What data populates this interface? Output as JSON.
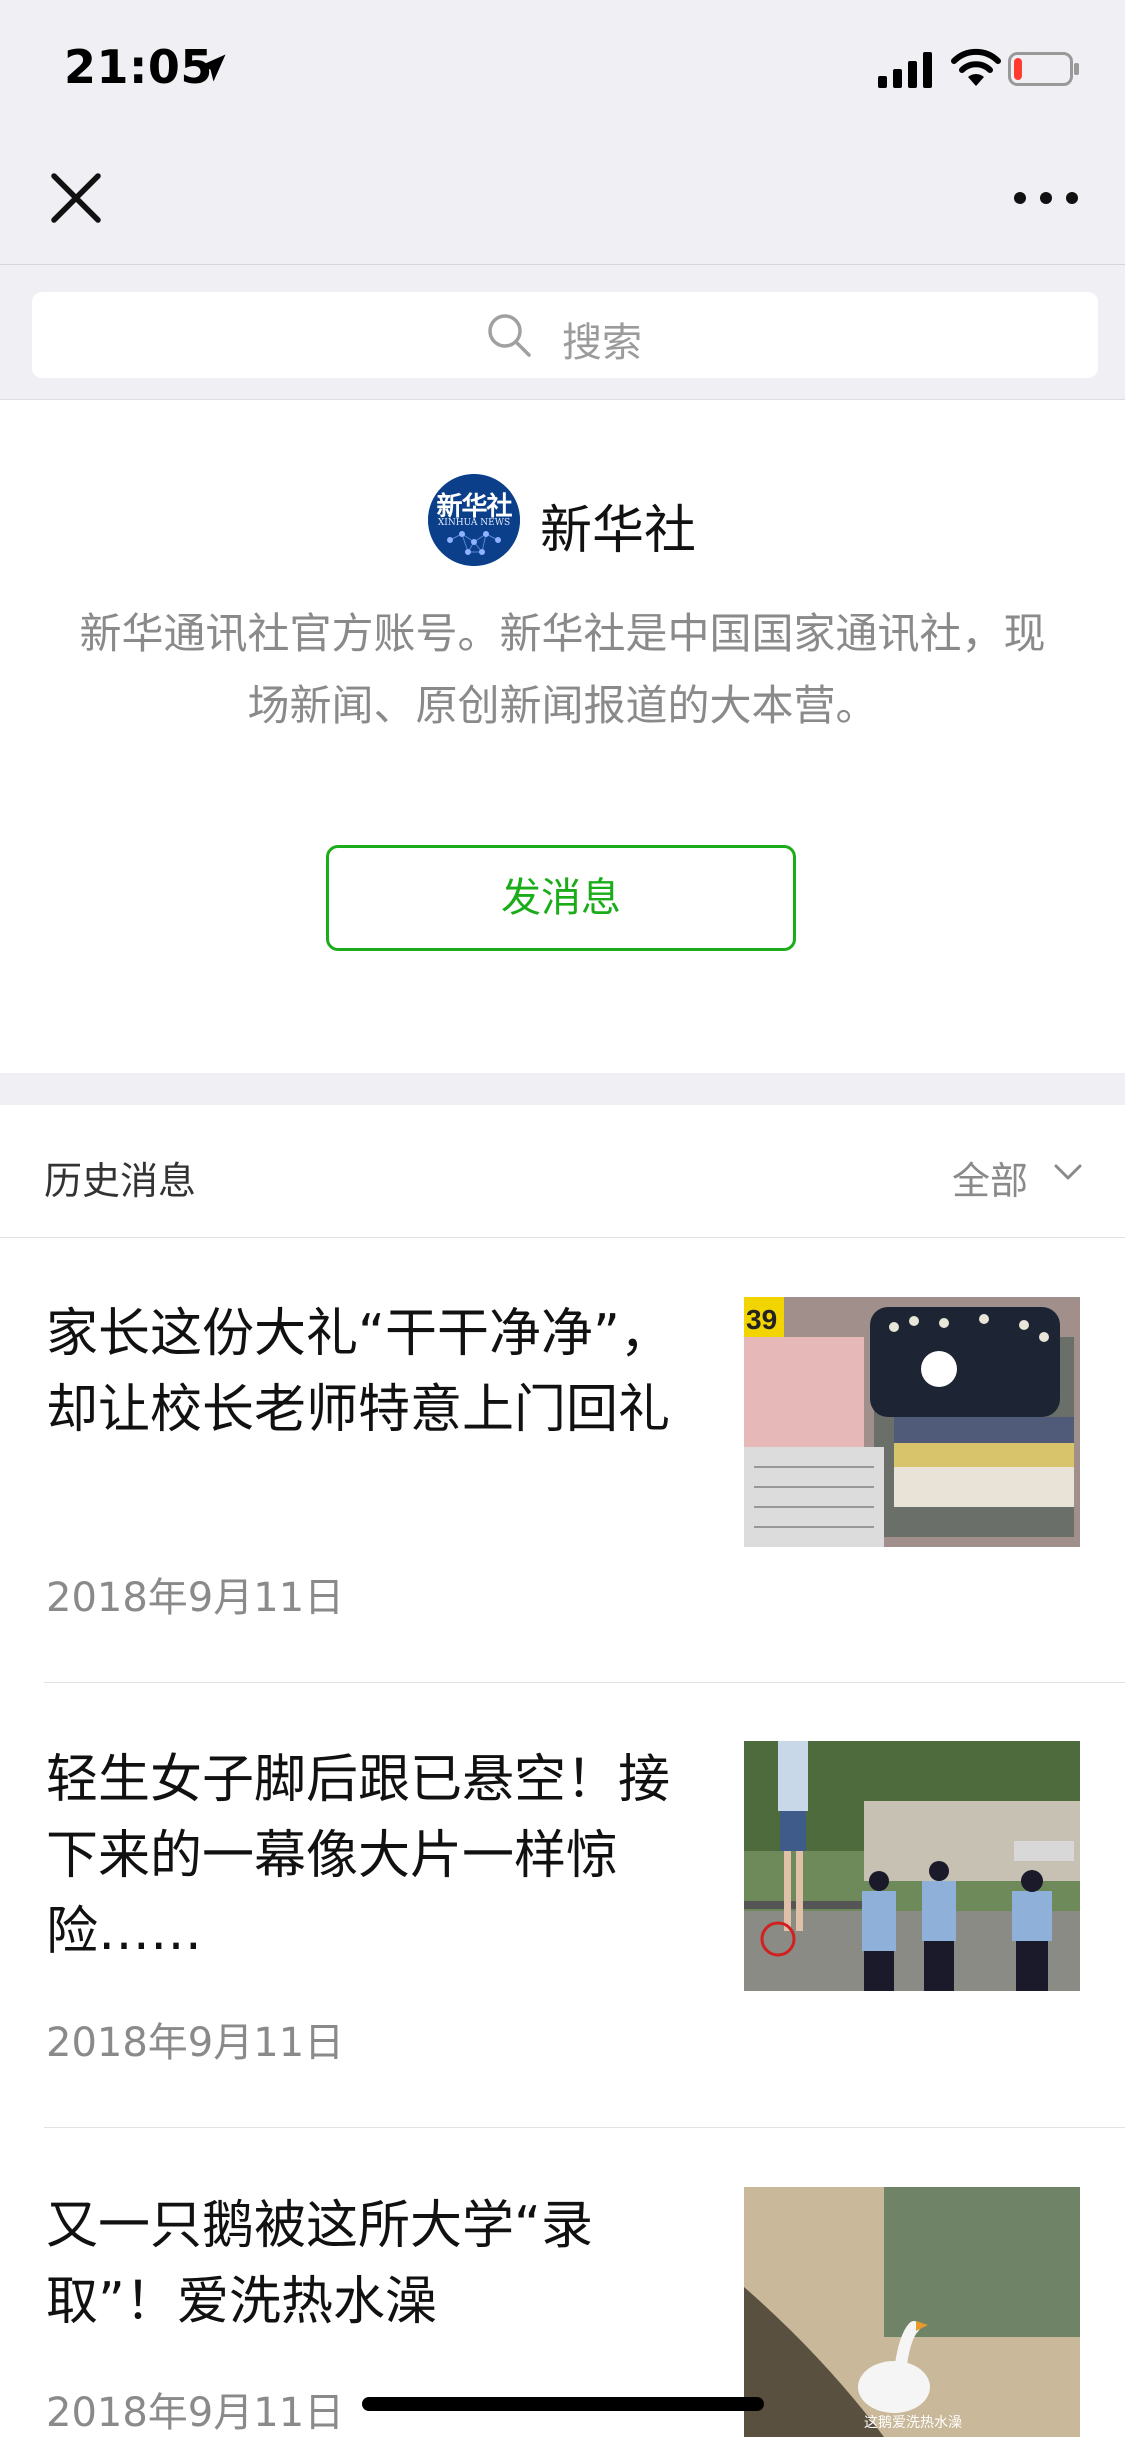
{
  "status_bar": {
    "time": "21:05",
    "battery_level": 0.15,
    "battery_color": "#ff3b30"
  },
  "nav": {
    "close_icon": "close-icon",
    "more_icon": "more-icon"
  },
  "search": {
    "placeholder": "搜索",
    "icon": "search-icon"
  },
  "account": {
    "avatar_text": "新华社",
    "avatar_subtext": "XINHUA NEWS",
    "name": "新华社",
    "description": "新华通讯社官方账号。新华社是中国国家通讯社，现场新闻、原创新闻报道的大本营。",
    "message_button": "发消息",
    "accent_color": "#1aad19"
  },
  "history": {
    "title": "历史消息",
    "filter_label": "全部",
    "articles": [
      {
        "title": "家长这份大礼“干干净净”，却让校长老师特意上门回礼",
        "date": "2018年9月11日"
      },
      {
        "title": "轻生女子脚后跟已悬空！接下来的一幕像大片一样惊险……",
        "date": "2018年9月11日"
      },
      {
        "title": "又一只鹅被这所大学“录取”！爱洗热水澡",
        "date": "2018年9月11日",
        "thumb_caption": "这鹅爱洗热水澡"
      }
    ]
  }
}
